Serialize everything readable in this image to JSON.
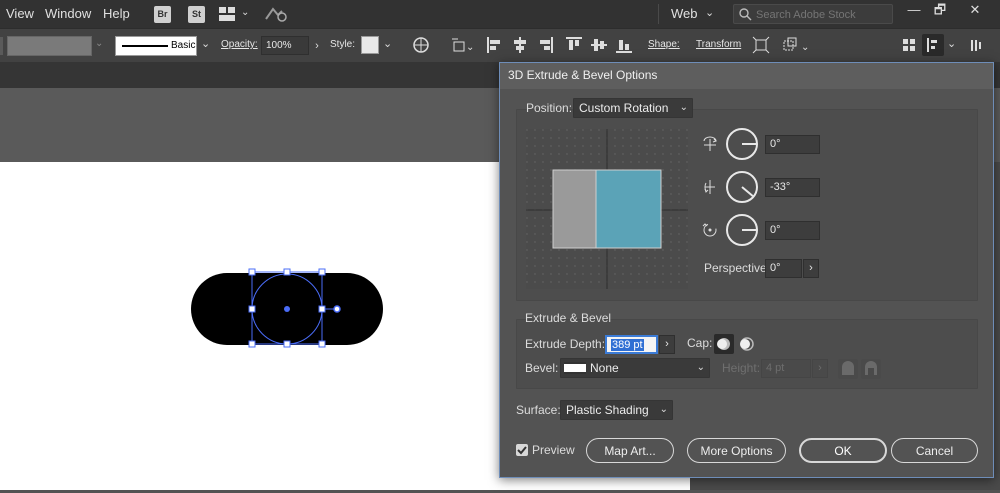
{
  "menu": {
    "items": [
      "View",
      "Window",
      "Help"
    ],
    "badges": [
      "Br",
      "St"
    ],
    "workspace": "Web",
    "search_placeholder": "Search Adobe Stock",
    "win_minimize": "—",
    "win_restore": "🗗",
    "win_close": "✕"
  },
  "controlbar": {
    "stroke_style": "Basic",
    "opacity_label": "Opacity:",
    "opacity_value": "100%",
    "style_label": "Style:",
    "shape_label": "Shape:",
    "transform_label": "Transform"
  },
  "dialog": {
    "title": "3D Extrude & Bevel Options",
    "position_label": "Position:",
    "position_value": "Custom Rotation",
    "rotation_x": "0°",
    "rotation_y": "-33°",
    "rotation_z": "0°",
    "perspective_label": "Perspective:",
    "perspective_value": "0°",
    "extrude_bevel_title": "Extrude & Bevel",
    "extrude_depth_label": "Extrude Depth:",
    "extrude_depth_value": "389 pt",
    "cap_label": "Cap:",
    "bevel_label": "Bevel:",
    "bevel_value": "None",
    "height_label": "Height:",
    "height_value": "4 pt",
    "surface_label": "Surface:",
    "surface_value": "Plastic Shading",
    "preview_label": "Preview",
    "preview_checked": true,
    "buttons": {
      "map_art": "Map Art...",
      "more_options": "More Options",
      "ok": "OK",
      "cancel": "Cancel"
    },
    "cube_colors": {
      "left_face": "#9a9a9a",
      "front_face": "#5ba3b7"
    }
  }
}
